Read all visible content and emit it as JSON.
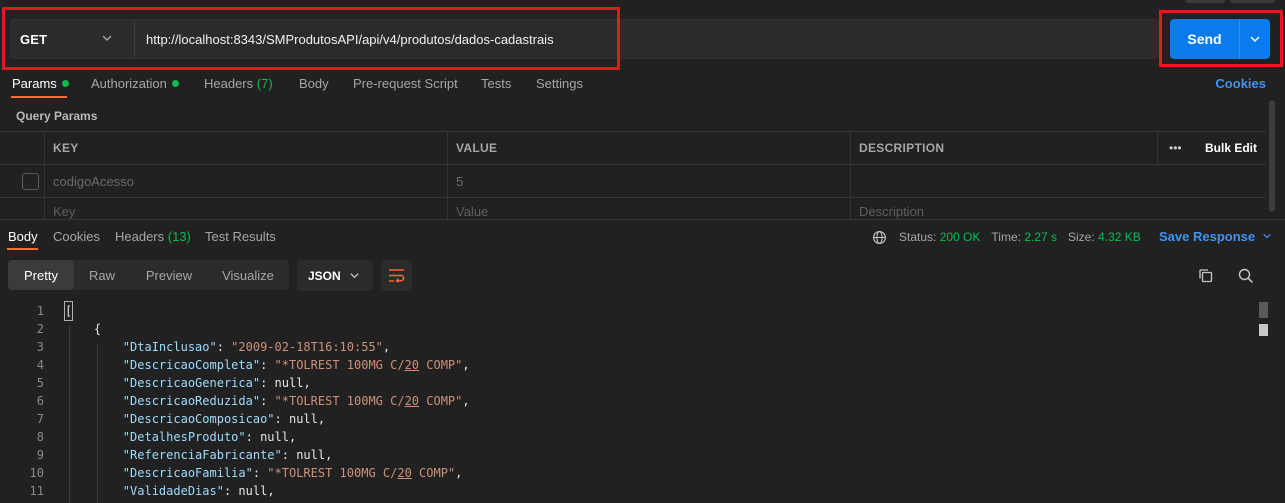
{
  "request": {
    "method": "GET",
    "url": "http://localhost:8343/SMProdutosAPI/api/v4/produtos/dados-cadastrais",
    "send_label": "Send"
  },
  "request_tabs": [
    {
      "label": "Params",
      "indicator": "green-dot",
      "active": true
    },
    {
      "label": "Authorization",
      "indicator": "green-dot"
    },
    {
      "label": "Headers",
      "count": "(7)"
    },
    {
      "label": "Body"
    },
    {
      "label": "Pre-request Script"
    },
    {
      "label": "Tests"
    },
    {
      "label": "Settings"
    }
  ],
  "cookies_label": "Cookies",
  "query_params": {
    "title": "Query Params",
    "headers": [
      "KEY",
      "VALUE",
      "DESCRIPTION"
    ],
    "more_label": "•••",
    "bulk_edit_label": "Bulk Edit",
    "rows": [
      {
        "key": "codigoAcesso",
        "value": "5",
        "description": ""
      }
    ],
    "placeholders": {
      "key": "Key",
      "value": "Value",
      "description": "Description"
    }
  },
  "response_tabs": [
    {
      "label": "Body",
      "active": true
    },
    {
      "label": "Cookies"
    },
    {
      "label": "Headers",
      "count": "(13)"
    },
    {
      "label": "Test Results"
    }
  ],
  "response_status": {
    "status_label": "Status:",
    "status_value": "200 OK",
    "time_label": "Time:",
    "time_value": "2.27 s",
    "size_label": "Size:",
    "size_value": "4.32 KB",
    "save_response_label": "Save Response"
  },
  "format_tabs": [
    "Pretty",
    "Raw",
    "Preview",
    "Visualize"
  ],
  "format_active": "Pretty",
  "language": "JSON",
  "code_lines": [
    {
      "n": "1",
      "text": "["
    },
    {
      "n": "2",
      "text": "    {"
    },
    {
      "n": "3",
      "key": "DtaInclusao",
      "value": "\"2009-02-18T16:10:55\"",
      "type": "string"
    },
    {
      "n": "4",
      "key": "DescricaoCompleta",
      "value": "\"*TOLREST 100MG C/20 COMP\"",
      "type": "string"
    },
    {
      "n": "5",
      "key": "DescricaoGenerica",
      "value": "null",
      "type": "null"
    },
    {
      "n": "6",
      "key": "DescricaoReduzida",
      "value": "\"*TOLREST 100MG C/20 COMP\"",
      "type": "string"
    },
    {
      "n": "7",
      "key": "DescricaoComposicao",
      "value": "null",
      "type": "null"
    },
    {
      "n": "8",
      "key": "DetalhesProduto",
      "value": "null",
      "type": "null"
    },
    {
      "n": "9",
      "key": "ReferenciaFabricante",
      "value": "null",
      "type": "null"
    },
    {
      "n": "10",
      "key": "DescricaoFamilia",
      "value": "\"*TOLREST 100MG C/20 COMP\"",
      "type": "string"
    },
    {
      "n": "11",
      "key": "ValidadeDias",
      "value": "null",
      "type": "null"
    }
  ],
  "colors": {
    "accent_orange": "#ff6c37",
    "send_blue": "#097bed",
    "status_green": "#0cbb52",
    "link_blue": "#3f93f5",
    "highlight_red": "#e21a20"
  }
}
